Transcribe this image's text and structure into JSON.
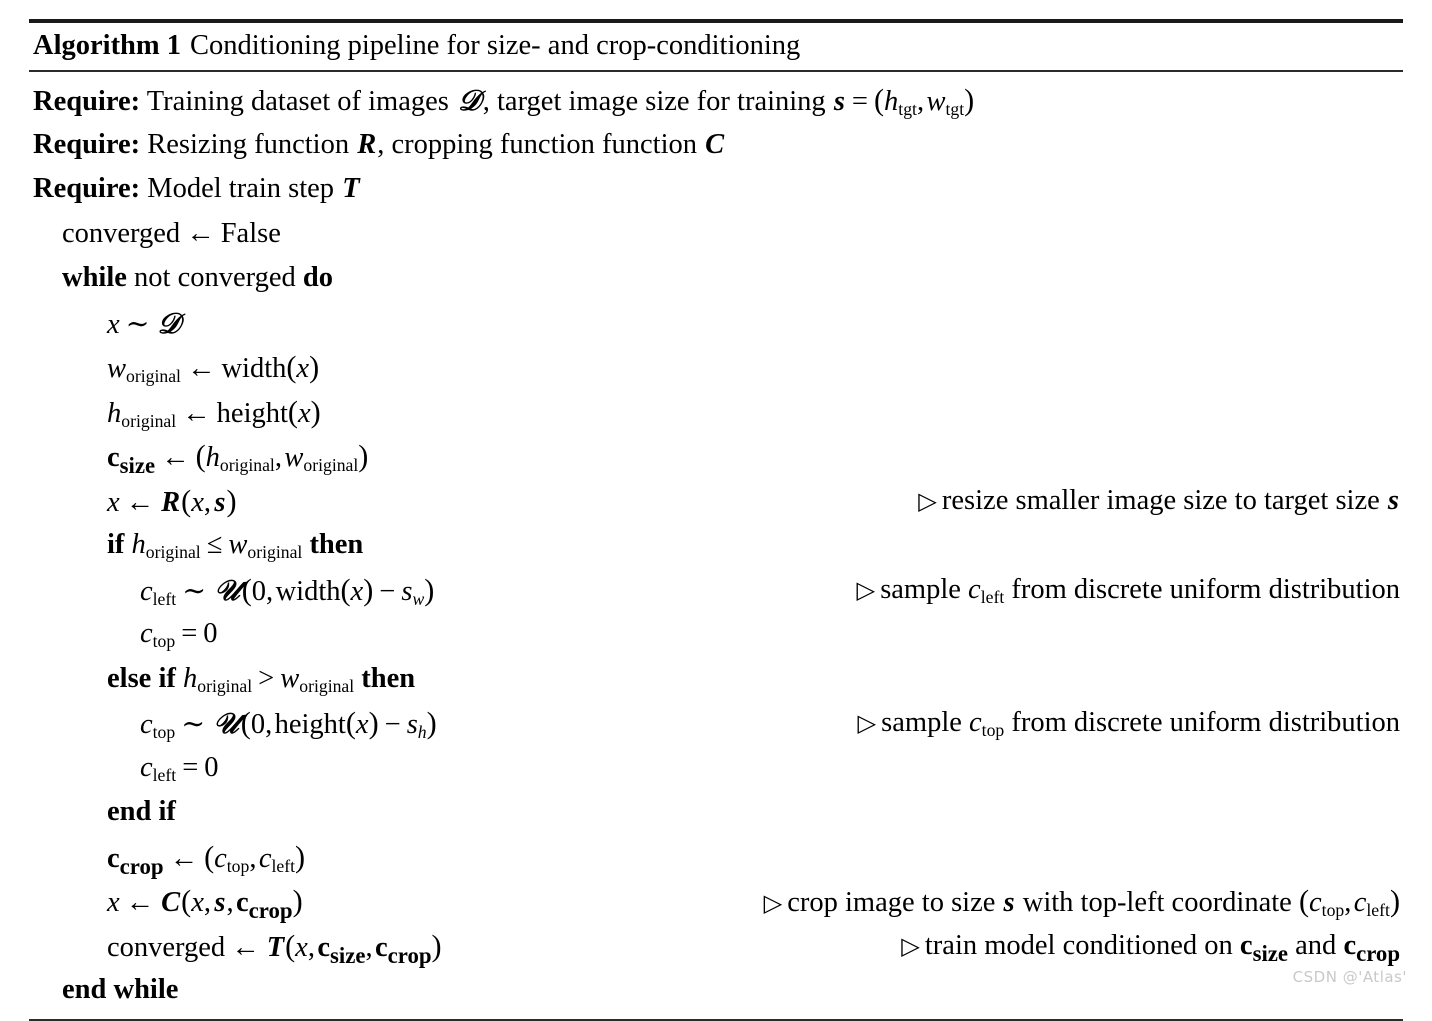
{
  "document": {
    "type": "algorithm-pseudocode",
    "caption": {
      "label": "Algorithm 1",
      "title": "Conditioning pipeline for size- and crop-conditioning"
    },
    "watermark": "CSDN @'Atlas'",
    "requires": [
      {
        "keyword": "Require:",
        "text_before": "Training dataset of images",
        "symbol_1": "D",
        "text_middle": ", target image size for training",
        "symbol_2": "s",
        "equals": "=",
        "tuple": "( h_tgt , w_tgt )"
      },
      {
        "keyword": "Require:",
        "text_before": "Resizing function",
        "symbol_1": "R",
        "text_middle": ", cropping function function",
        "symbol_2": "C"
      },
      {
        "keyword": "Require:",
        "text_before": "Model train step",
        "symbol_1": "T"
      }
    ],
    "statements": [
      {
        "id": "init-converged",
        "indent": 1,
        "plain": "converged ← False",
        "comment": ""
      },
      {
        "id": "while-loop",
        "indent": 1,
        "plain": "while not converged do",
        "comment": ""
      },
      {
        "id": "sample-x",
        "indent": 2,
        "plain": "x ~ D",
        "comment": ""
      },
      {
        "id": "w-original",
        "indent": 2,
        "plain": "w_original ← width(x)",
        "comment": ""
      },
      {
        "id": "h-original",
        "indent": 2,
        "plain": "h_original ← height(x)",
        "comment": ""
      },
      {
        "id": "c-size",
        "indent": 2,
        "plain": "c_size ← (h_original, w_original)",
        "comment": ""
      },
      {
        "id": "resize-x",
        "indent": 2,
        "plain": "x ← R(x, s)",
        "comment": "▷ resize smaller image size to target size s"
      },
      {
        "id": "if-branch",
        "indent": 2,
        "plain": "if h_original ≤ w_original then",
        "comment": ""
      },
      {
        "id": "sample-c-left",
        "indent": 3,
        "plain": "c_left ~ U(0, width(x) − s_w)",
        "comment": "▷ sample c_left from discrete uniform distribution"
      },
      {
        "id": "c-top-zero",
        "indent": 3,
        "plain": "c_top = 0",
        "comment": ""
      },
      {
        "id": "else-if-branch",
        "indent": 2,
        "plain": "else if h_original > w_original then",
        "comment": ""
      },
      {
        "id": "sample-c-top",
        "indent": 3,
        "plain": "c_top ~ U(0, height(x) − s_h)",
        "comment": "▷ sample c_top from discrete uniform distribution"
      },
      {
        "id": "c-left-zero",
        "indent": 3,
        "plain": "c_left = 0",
        "comment": ""
      },
      {
        "id": "end-if",
        "indent": 2,
        "plain": "end if",
        "comment": ""
      },
      {
        "id": "c-crop",
        "indent": 2,
        "plain": "c_crop ← (c_top, c_left)",
        "comment": ""
      },
      {
        "id": "crop-x",
        "indent": 2,
        "plain": "x ← C(x, s, c_crop)",
        "comment": "▷ crop image to size s with top-left coordinate (c_top, c_left)"
      },
      {
        "id": "train-step",
        "indent": 2,
        "plain": "converged ← T(x, c_size, c_crop)",
        "comment": "▷ train model conditioned on c_size and c_crop"
      },
      {
        "id": "end-while",
        "indent": 1,
        "plain": "end while",
        "comment": ""
      }
    ],
    "tokens": {
      "require": "Require:",
      "kw_while": "while",
      "kw_not": "not",
      "kw_do": "do",
      "kw_if": "if",
      "kw_else": "else",
      "kw_then": "then",
      "kw_end": "end",
      "converged": "converged",
      "false_literal": "False",
      "width_fn": "width",
      "height_fn": "height",
      "sub_original": "original",
      "sub_tgt": "tgt",
      "sub_left": "left",
      "sub_top": "top",
      "sub_size": "size",
      "sub_crop": "crop",
      "sub_w": "w",
      "sub_h": "h",
      "var_x": "x",
      "var_w": "w",
      "var_h": "h",
      "var_c": "c",
      "var_s": "s",
      "sym_D": "𝒟",
      "sym_U": "𝒰",
      "sym_R": "R",
      "sym_C": "C",
      "sym_T": "T",
      "arrow": "←",
      "tilde": "∼",
      "equals": "=",
      "leq": "≤",
      "gt": ">",
      "minus": "−",
      "zero": "0",
      "comma": ",",
      "lparen": "(",
      "rparen": ")",
      "triangle": "▷",
      "txt_resize_comment": "resize smaller image size to target size",
      "txt_sample": "sample",
      "txt_from_uniform": "from discrete uniform distribution",
      "txt_crop_image_to_size": "crop image to size",
      "txt_with_topleft": "with top-left coordinate",
      "txt_train_model": "train model conditioned on",
      "txt_and": "and",
      "txt_training_dataset": "Training dataset of images",
      "txt_target_size": ", target image size for training",
      "txt_resizing_fn": "Resizing function",
      "txt_cropping_fn": ", cropping function function",
      "txt_model_train_step": "Model train step"
    }
  }
}
